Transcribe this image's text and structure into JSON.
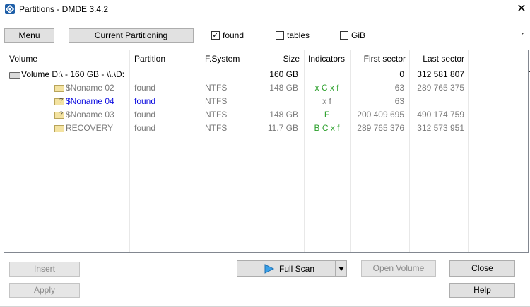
{
  "window": {
    "title": "Partitions - DMDE 3.4.2",
    "close_glyph": "✕"
  },
  "toolbar": {
    "menu_label": "Menu",
    "current_partitioning_label": "Current Partitioning",
    "found": {
      "label": "found",
      "checked": true
    },
    "tables": {
      "label": "tables",
      "checked": false
    },
    "gib": {
      "label": "GiB",
      "checked": false
    }
  },
  "columns": [
    "Volume",
    "Partition",
    "F.System",
    "Size",
    "Indicators",
    "First sector",
    "Last sector"
  ],
  "volume_row": {
    "name": "Volume D:\\ - 160 GB - \\\\.\\D:",
    "size": "160 GB",
    "first": "0",
    "last": "312 581 807"
  },
  "rows": [
    {
      "name": "$Noname 02",
      "partition": "found",
      "fs": "NTFS",
      "size": "148 GB",
      "indicators": "x C x f",
      "first": "63",
      "last": "289 765 375"
    },
    {
      "name": "$Noname 04",
      "partition": "found",
      "fs": "NTFS",
      "size": "",
      "indicators": "x f",
      "first": "63",
      "last": ""
    },
    {
      "name": "$Noname 03",
      "partition": "found",
      "fs": "NTFS",
      "size": "148 GB",
      "indicators": "F",
      "first": "200 409 695",
      "last": "490 174 759"
    },
    {
      "name": "RECOVERY",
      "partition": "found",
      "fs": "NTFS",
      "size": "11.7 GB",
      "indicators": "B C x f",
      "first": "289 765 376",
      "last": "312 573 951"
    }
  ],
  "buttons": {
    "insert": "Insert",
    "apply": "Apply",
    "full_scan": "Full Scan",
    "open_volume": "Open Volume",
    "close": "Close",
    "help": "Help"
  },
  "colors": {
    "selected_row_text": "#1010e0",
    "indicator_text": "#2ca02c",
    "muted_text": "#7a7a7a"
  }
}
